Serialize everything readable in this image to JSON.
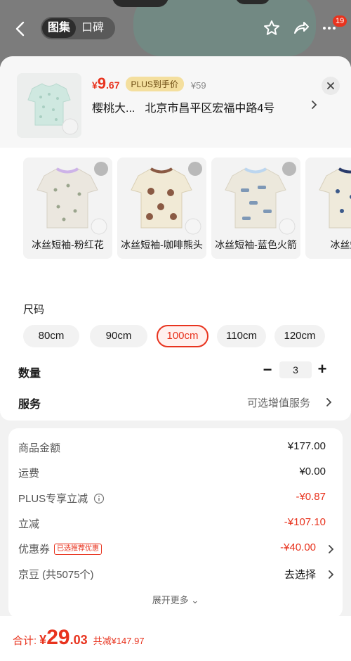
{
  "header": {
    "tabs": [
      "图集",
      "口碑"
    ],
    "active_tab": 0,
    "cart_badge": "19"
  },
  "product": {
    "price_currency": "¥",
    "price_int": "9",
    "price_dec": ".67",
    "plus_tag": "PLUS到手价",
    "original_price": "¥59",
    "shop_name": "樱桃大...",
    "address": "北京市昌平区宏福中路4号"
  },
  "variants": [
    {
      "label": "冰丝短袖-粉红花",
      "trim": "#cdb3e8"
    },
    {
      "label": "冰丝短袖-咖啡熊头",
      "trim": "#8a5a44"
    },
    {
      "label": "冰丝短袖-蓝色火箭",
      "trim": "#bcd6ef"
    },
    {
      "label": "冰丝短袖",
      "trim": "#2a3b6a"
    }
  ],
  "size": {
    "title": "尺码",
    "options": [
      "80cm",
      "90cm",
      "100cm",
      "110cm",
      "120cm"
    ],
    "selected": 2
  },
  "quantity": {
    "label": "数量",
    "value": "3",
    "minus": "−",
    "plus": "+"
  },
  "service": {
    "label": "服务",
    "value": "可选增值服务"
  },
  "breakdown": {
    "rows": [
      {
        "label": "商品金额",
        "value": "¥177.00"
      },
      {
        "label": "运费",
        "value": "¥0.00"
      },
      {
        "label": "PLUS专享立减",
        "value": "-¥0.87"
      },
      {
        "label": "立减",
        "value": "-¥107.10"
      },
      {
        "label": "优惠券",
        "tag": "已选推荐优惠",
        "value": "-¥40.00"
      },
      {
        "label": "京豆 (共5075个)",
        "value": "去选择"
      }
    ],
    "more": "展开更多 ⌄"
  },
  "total": {
    "label": "合计:",
    "currency": "¥",
    "int": "29",
    "dec": ".03",
    "saved": "共减¥147.97"
  },
  "colors": {
    "accent": "#e8331e",
    "plus_gold": "#f4df9e"
  }
}
